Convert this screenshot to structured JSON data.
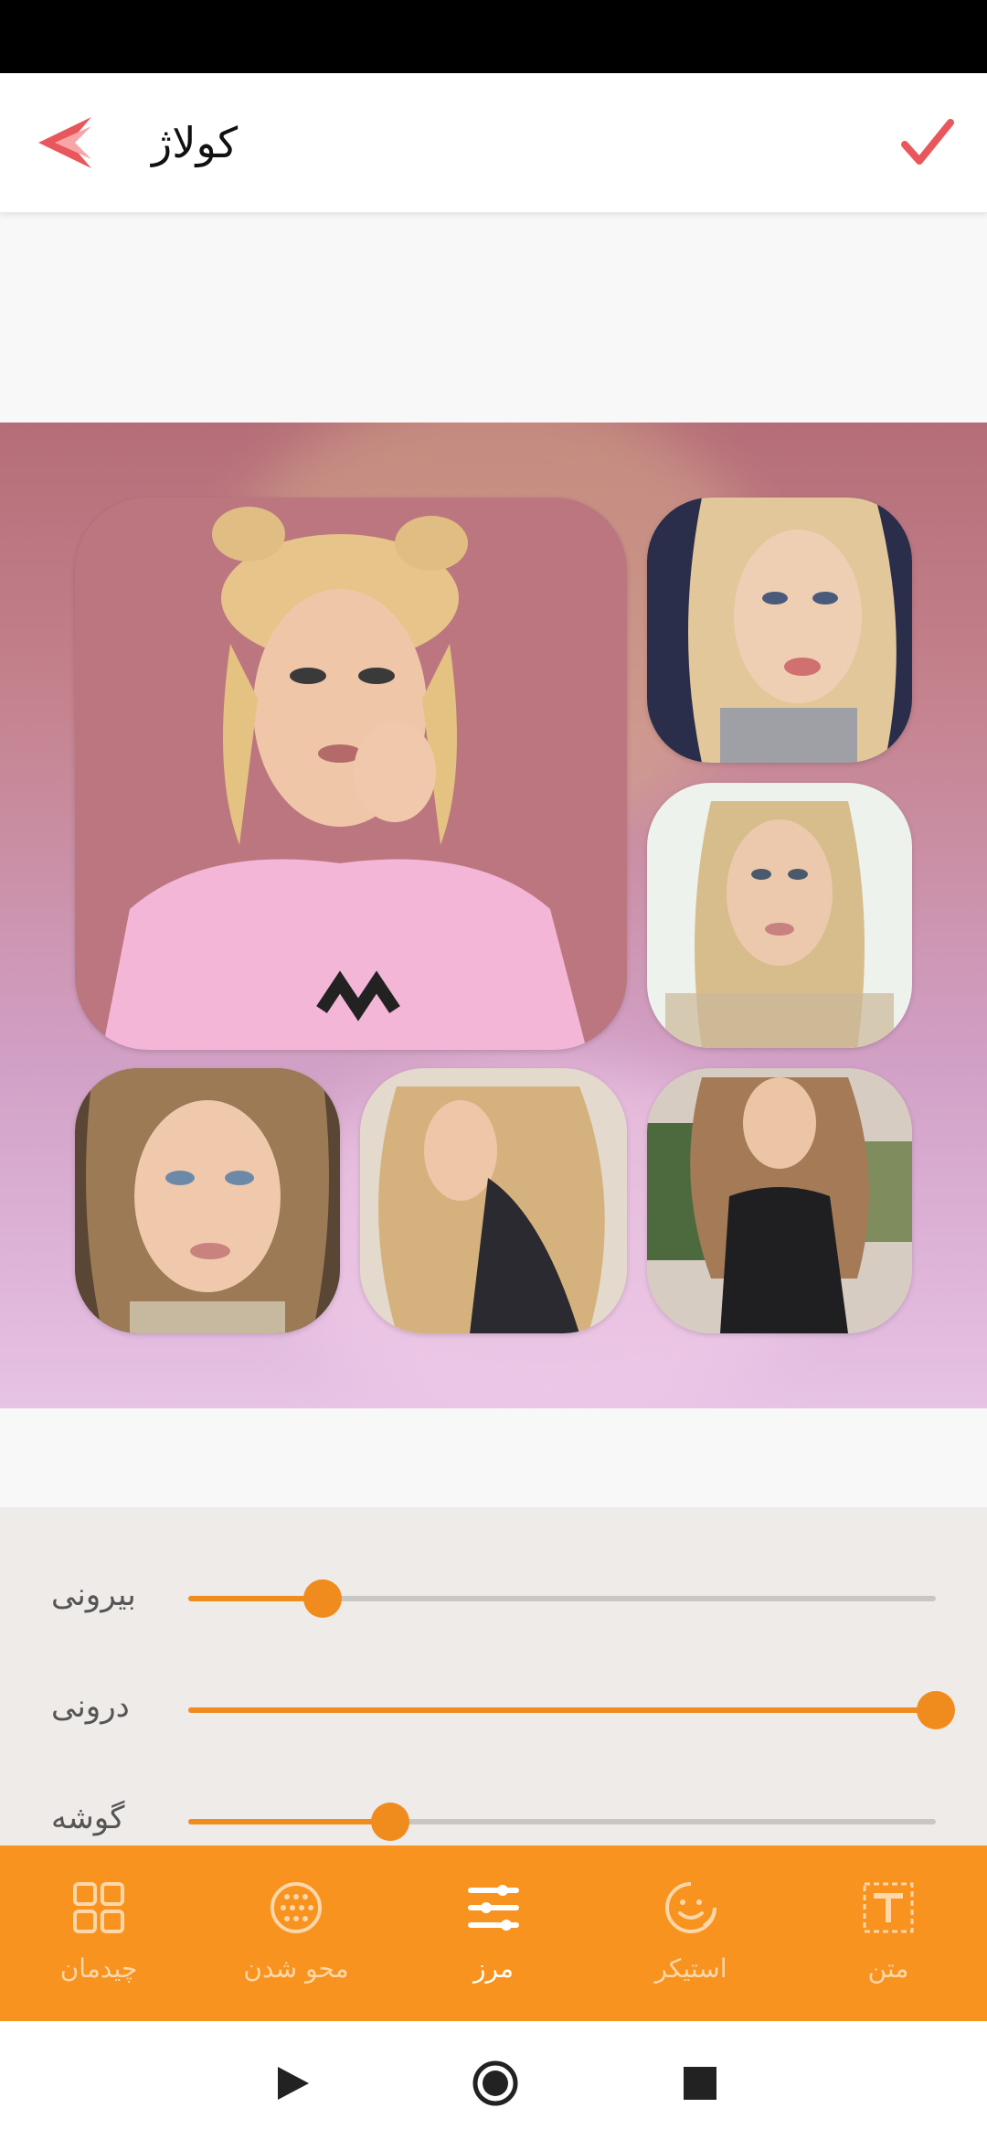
{
  "app_bar": {
    "title": "کولاژ",
    "back_icon": "double-chevron-left-icon",
    "confirm_icon": "check-icon"
  },
  "colors": {
    "accent": "#f08c1e",
    "nav_background": "#f7931e",
    "icon_red": "#e8575b"
  },
  "collage": {
    "tiles": [
      "photo-1",
      "photo-2",
      "photo-3",
      "photo-4",
      "photo-5",
      "photo-6"
    ]
  },
  "border_panel": {
    "sliders": [
      {
        "label": "بیرونی",
        "value_fraction": 0.18
      },
      {
        "label": "درونی",
        "value_fraction": 1.0
      },
      {
        "label": "گوشه",
        "value_fraction": 0.27
      }
    ]
  },
  "bottom_nav": {
    "items": [
      {
        "label": "چیدمان",
        "icon": "layout-icon"
      },
      {
        "label": "محو شدن",
        "icon": "blur-icon"
      },
      {
        "label": "مرز",
        "icon": "border-icon",
        "active": true
      },
      {
        "label": "استیکر",
        "icon": "sticker-icon"
      },
      {
        "label": "متن",
        "icon": "text-icon"
      }
    ]
  },
  "system_nav": {
    "back_icon": "triangle-play-icon",
    "home_icon": "circle-home-icon",
    "recents_icon": "square-recents-icon"
  }
}
